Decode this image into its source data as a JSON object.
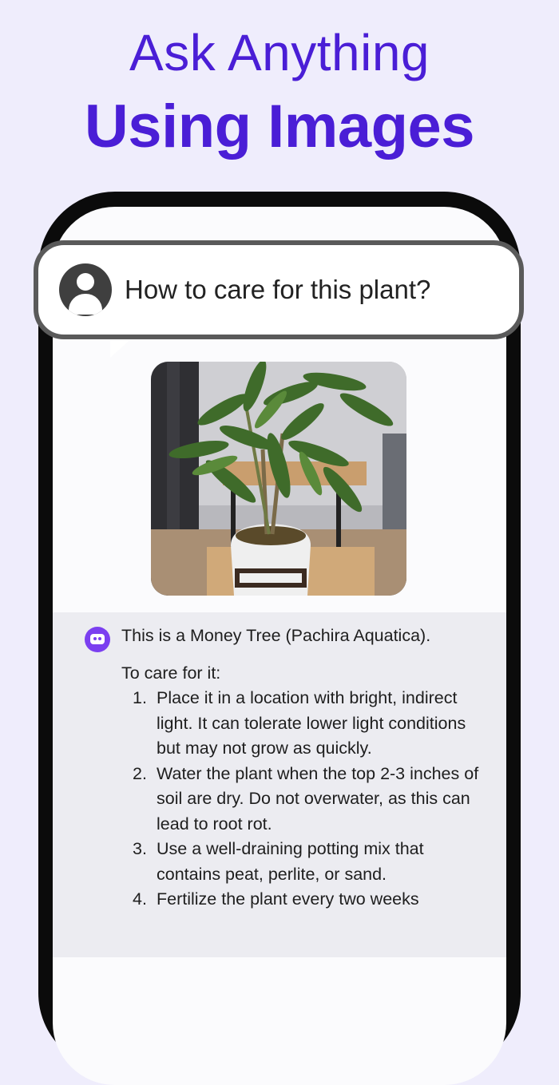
{
  "header": {
    "line1": "Ask Anything",
    "line2": "Using Images"
  },
  "question": {
    "text": "How to care for this plant?",
    "avatar_icon": "user-avatar-icon"
  },
  "photo": {
    "subject": "money-tree-plant-in-pot"
  },
  "answer": {
    "bot_icon": "chatbot-icon",
    "intro": "This is a Money Tree (Pachira Aquatica).",
    "lead": "To care for it:",
    "steps": [
      {
        "num": "1.",
        "text": "Place it in a location with bright, indirect light. It can tolerate lower light conditions but may not grow as quickly."
      },
      {
        "num": "2.",
        "text": "Water the plant when the top 2-3 inches of soil are dry. Do not overwater, as this can lead to root rot."
      },
      {
        "num": "3.",
        "text": "Use a well-draining potting mix that contains peat, perlite, or sand."
      },
      {
        "num": "4.",
        "text": "Fertilize the plant every two weeks"
      }
    ]
  },
  "colors": {
    "background": "#efedfc",
    "accent": "#4a1ed6",
    "bot": "#7b3ff0"
  }
}
